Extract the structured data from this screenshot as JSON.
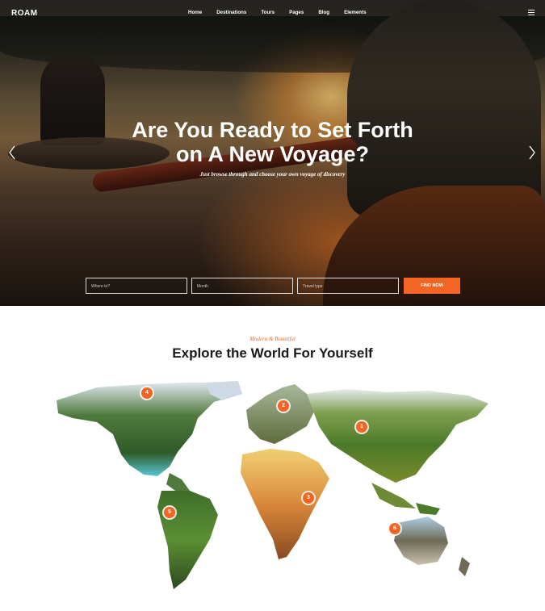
{
  "brand": {
    "logo": "ROAM"
  },
  "nav": {
    "items": [
      "Home",
      "Destinations",
      "Tours",
      "Pages",
      "Blog",
      "Elements"
    ],
    "menu_icon": "hamburger-icon"
  },
  "hero": {
    "title_line1": "Are You Ready to Set Forth",
    "title_line2": "on A New Voyage?",
    "subtitle": "Just browse through and choose your own voyage of discovery",
    "prev_icon": "chevron-left-icon",
    "next_icon": "chevron-right-icon"
  },
  "search": {
    "field1_placeholder": "Where to?",
    "field2_placeholder": "Month",
    "field3_placeholder": "Travel type",
    "button_label": "FIND NOW"
  },
  "explore": {
    "eyebrow": "Modern & Beautiful",
    "title": "Explore the World For Yourself",
    "pins": [
      "1",
      "2",
      "3",
      "4",
      "5",
      "6"
    ]
  },
  "colors": {
    "accent": "#f26522",
    "title": "#1a1a1a"
  }
}
